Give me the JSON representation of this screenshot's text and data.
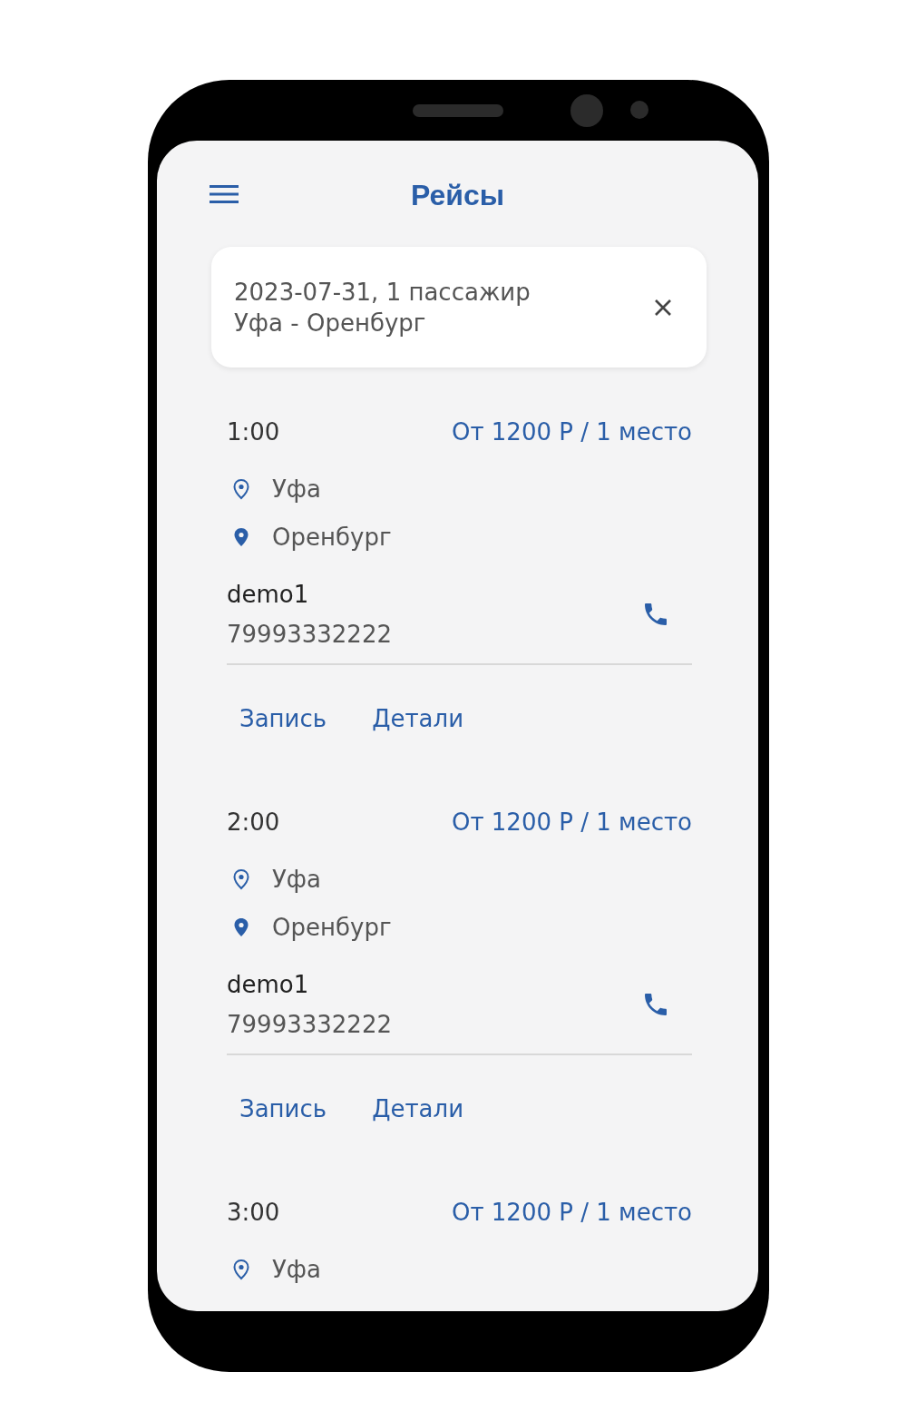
{
  "app_bar": {
    "title": "Рейсы"
  },
  "search_summary": {
    "line_1": "2023-07-31, 1 пассажир",
    "line_2": "Уфа - Оренбург"
  },
  "trips": [
    {
      "time": "1:00",
      "price": "От 1200 Р / 1 место",
      "origin": "Уфа",
      "destination": "Оренбург",
      "driver": "demo1",
      "phone": "79993332222",
      "actions": [
        "Запись",
        "Детали"
      ]
    },
    {
      "time": "2:00",
      "price": "От 1200 Р / 1 место",
      "origin": "Уфа",
      "destination": "Оренбург",
      "driver": "demo1",
      "phone": "79993332222",
      "actions": [
        "Запись",
        "Детали"
      ]
    },
    {
      "time": "3:00",
      "price": "От 1200 Р / 1 место",
      "origin": "Уфа"
    }
  ]
}
